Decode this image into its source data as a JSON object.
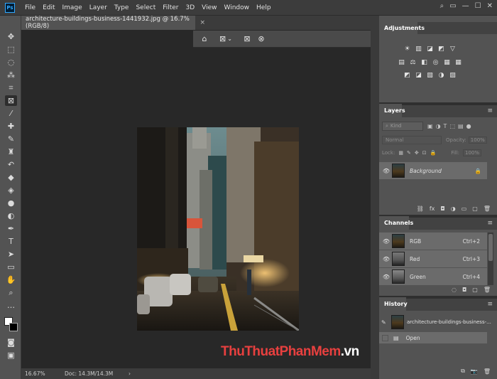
{
  "app": {
    "logo": "Ps"
  },
  "menu": [
    "File",
    "Edit",
    "Image",
    "Layer",
    "Type",
    "Select",
    "Filter",
    "3D",
    "View",
    "Window",
    "Help"
  ],
  "window_controls": {
    "search": "⌕",
    "panels": "▭",
    "minimize": "—",
    "maximize": "☐",
    "close": "✕"
  },
  "document": {
    "tab_title": "architecture-buildings-business-1441932.jpg @ 16.7% (RGB/8)",
    "close_glyph": "×"
  },
  "options_bar": {
    "home": "⌂",
    "frame": "⊠",
    "chevron": "⌄",
    "rect_frame": "⊠",
    "ellipse_frame": "⊗"
  },
  "status": {
    "zoom": "16.67%",
    "doc": "Doc: 14.3M/14.3M",
    "arrow": "›"
  },
  "watermark": {
    "part1": "ThuThuat",
    "part2": "PhanMem",
    "part3": ".vn",
    "color1": "#e8403f",
    "color2": "#ffffff"
  },
  "panels": {
    "adjustments": {
      "title": "Adjustments",
      "row1": [
        "☀",
        "▥",
        "◪",
        "◩",
        "▽"
      ],
      "row2": [
        "▤",
        "⚖",
        "◧",
        "◎",
        "▦"
      ],
      "row3": [
        "◩",
        "◪",
        "▧",
        "◑",
        "▨"
      ]
    },
    "layers": {
      "title": "Layers",
      "filter_label": "Kind",
      "blend_mode": "Normal",
      "opacity_label": "Opacity:",
      "opacity_value": "100%",
      "lock_label": "Lock:",
      "fill_label": "Fill:",
      "fill_value": "100%",
      "layer_name": "Background",
      "footer": [
        "⛓",
        "fx",
        "◘",
        "◑",
        "▭",
        "▢",
        "🗑"
      ]
    },
    "channels": {
      "title": "Channels",
      "items": [
        {
          "name": "RGB",
          "shortcut": "Ctrl+2"
        },
        {
          "name": "Red",
          "shortcut": "Ctrl+3"
        },
        {
          "name": "Green",
          "shortcut": "Ctrl+4"
        }
      ],
      "footer": [
        "◌",
        "◘",
        "▢",
        "🗑"
      ]
    },
    "history": {
      "title": "History",
      "snapshot": "architecture-buildings-business-...",
      "step": "Open",
      "footer": [
        "⧉",
        "📷",
        "🗑"
      ]
    }
  }
}
